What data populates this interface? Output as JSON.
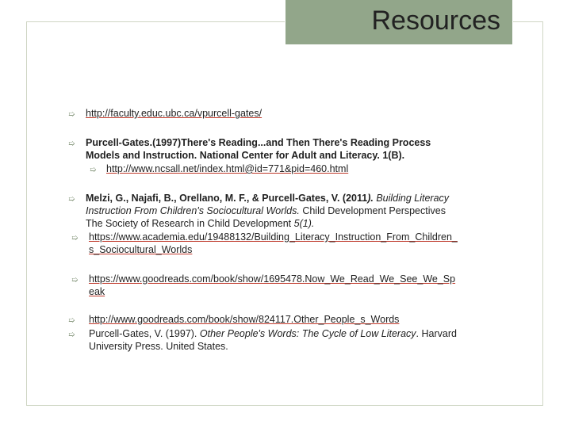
{
  "slide": {
    "title": "Resources"
  },
  "items": {
    "link1": "http://faculty.educ.ubc.ca/vpurcell-gates/",
    "ref2_line1": "Purcell-Gates.(1997)There's Reading...and  Then There's Reading Process",
    "ref2_line2": "Models and Instruction. National Center for Adult and Literacy. 1(B).",
    "link2": "http://www.ncsall.net/index.html@id=771&pid=460.html",
    "ref3_authors": "Melzi, G., Najafi, B., Orellano, M. F., & Purcell-Gates, V. (2011",
    "ref3_paren": ").",
    "ref3_title_a": " Building Literacy",
    "ref3_title_b": "Instruction From Children's Sociocultural Worlds.",
    "ref3_line2_rest": " Child Development Perspectives",
    "ref3_line3a": "The Society of Research in Child  Development ",
    "ref3_line3b": "5(1).",
    "link3_line1": "https://www.academia.edu/19488132/Building_Literacy_Instruction_From_Children_",
    "link3_line2": "s_Sociocultural_Worlds",
    "link4_line1": "https://www.goodreads.com/book/show/1695478.Now_We_Read_We_See_We_Sp",
    "link4_line2": "eak",
    "link5": "http://www.goodreads.com/book/show/824117.Other_People_s_Words",
    "ref6_a": "Purcell-Gates, V. (1997). ",
    "ref6_title": "Other People's Words: The Cycle of Low Literacy",
    "ref6_b": ". Harvard",
    "ref6_line2": "University Press. United States.",
    "bullet_glyph": "➯"
  },
  "colors": {
    "title_box": "#92a68a",
    "bullet": "#7d8f73",
    "link_underline": "#c0392b"
  }
}
